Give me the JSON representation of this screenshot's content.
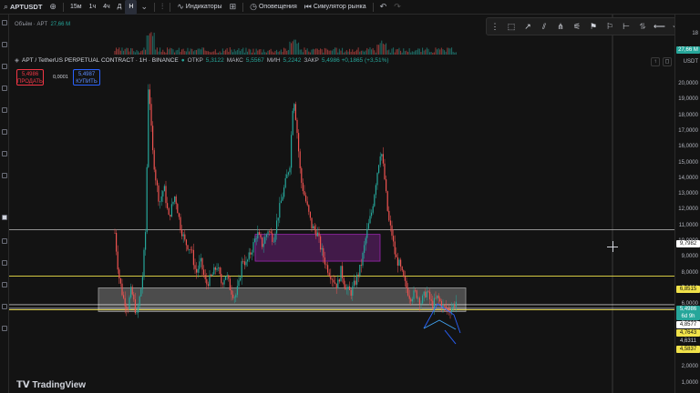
{
  "toolbar": {
    "symbol": "APTUSDT",
    "timeframes": [
      "15м",
      "1ч",
      "4ч",
      "Д",
      "Н"
    ],
    "active_timeframe": "Н",
    "indicators_label": "Индикаторы",
    "alerts_label": "Оповещения",
    "replay_label": "Симулятор рынка"
  },
  "volume_label": "Объём · APT",
  "volume_value": "27,66 M",
  "legend": {
    "title": "APT / TetherUS PERPETUAL CONTRACT · 1H · BINANCE",
    "open_k": "ОТКР",
    "open_v": "5,3122",
    "high_k": "МАКС",
    "high_v": "5,5567",
    "low_k": "МИН",
    "low_v": "5,2242",
    "close_k": "ЗАКР",
    "close_v": "5,4986 +0,1865 (+3,51%)"
  },
  "trade": {
    "sell_price": "5,4986",
    "sell_label": "ПРОДАТЬ",
    "buy_price": "5,4987",
    "buy_label": "КУПИТЬ",
    "spread": "0,0001"
  },
  "price_axis": {
    "top_label": "18",
    "volume_tag": "27,66 M",
    "currency": "USDT",
    "ticks": [
      "20,0000",
      "19,0000",
      "18,0000",
      "17,0000",
      "16,0000",
      "15,0000",
      "14,0000",
      "13,0000",
      "12,0000",
      "11,0000",
      "10,0000",
      "9,0000",
      "8,0000",
      "7,0000",
      "6,0000",
      "5,0000",
      "4,0000",
      "3,0000",
      "2,0000",
      "1,0000",
      "0,0000"
    ],
    "tag_9798": "9,7982",
    "tag_6851": "6,8515",
    "tag_last": "5,4986",
    "tag_countdown": "6d 9h",
    "tag_4857": "4,8577",
    "tag_4764": "4,7643",
    "tag_4631": "4,6311",
    "tag_4583": "4,5837"
  },
  "brand": "TradingView",
  "colors": {
    "up": "#26a69a",
    "down": "#ef5350",
    "accent_yellow": "#f0e24a",
    "zone_purple": "#9c27b0"
  }
}
